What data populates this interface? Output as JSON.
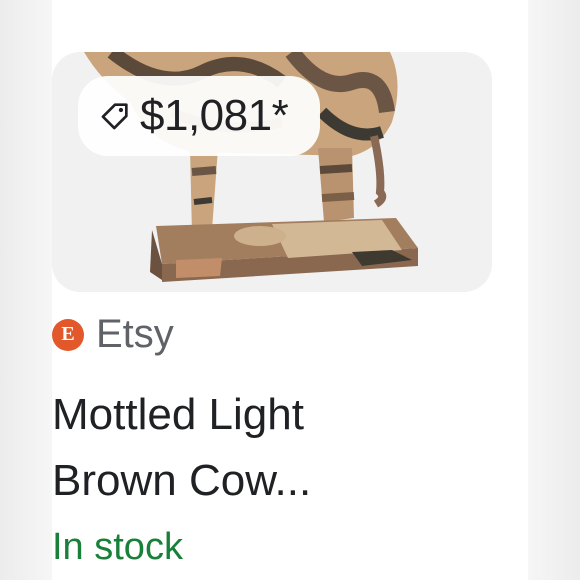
{
  "product": {
    "price": "$1,081*",
    "merchant": "Etsy",
    "merchant_logo_letter": "E",
    "title_line1": "Mottled Light",
    "title_line2": "Brown Cow...",
    "availability": "In stock"
  },
  "colors": {
    "availability": "#188038",
    "merchant_logo": "#e2582a"
  }
}
